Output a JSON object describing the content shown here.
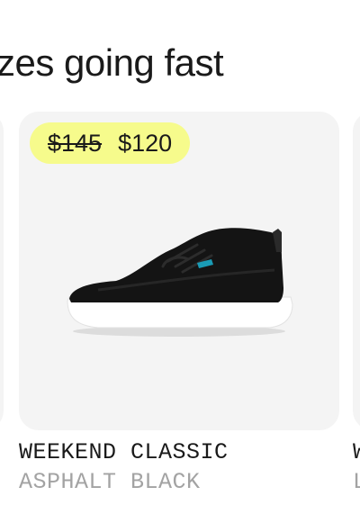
{
  "section": {
    "heading": "zes going fast"
  },
  "products": [
    {
      "price_original": "$145",
      "price_sale": "$120",
      "name": "WEEKEND CLASSIC",
      "color": "ASPHALT BLACK",
      "accent_color": "#1a9bb5",
      "badge_color": "#f6fb8c"
    },
    {
      "name": "W",
      "color": "L"
    }
  ]
}
